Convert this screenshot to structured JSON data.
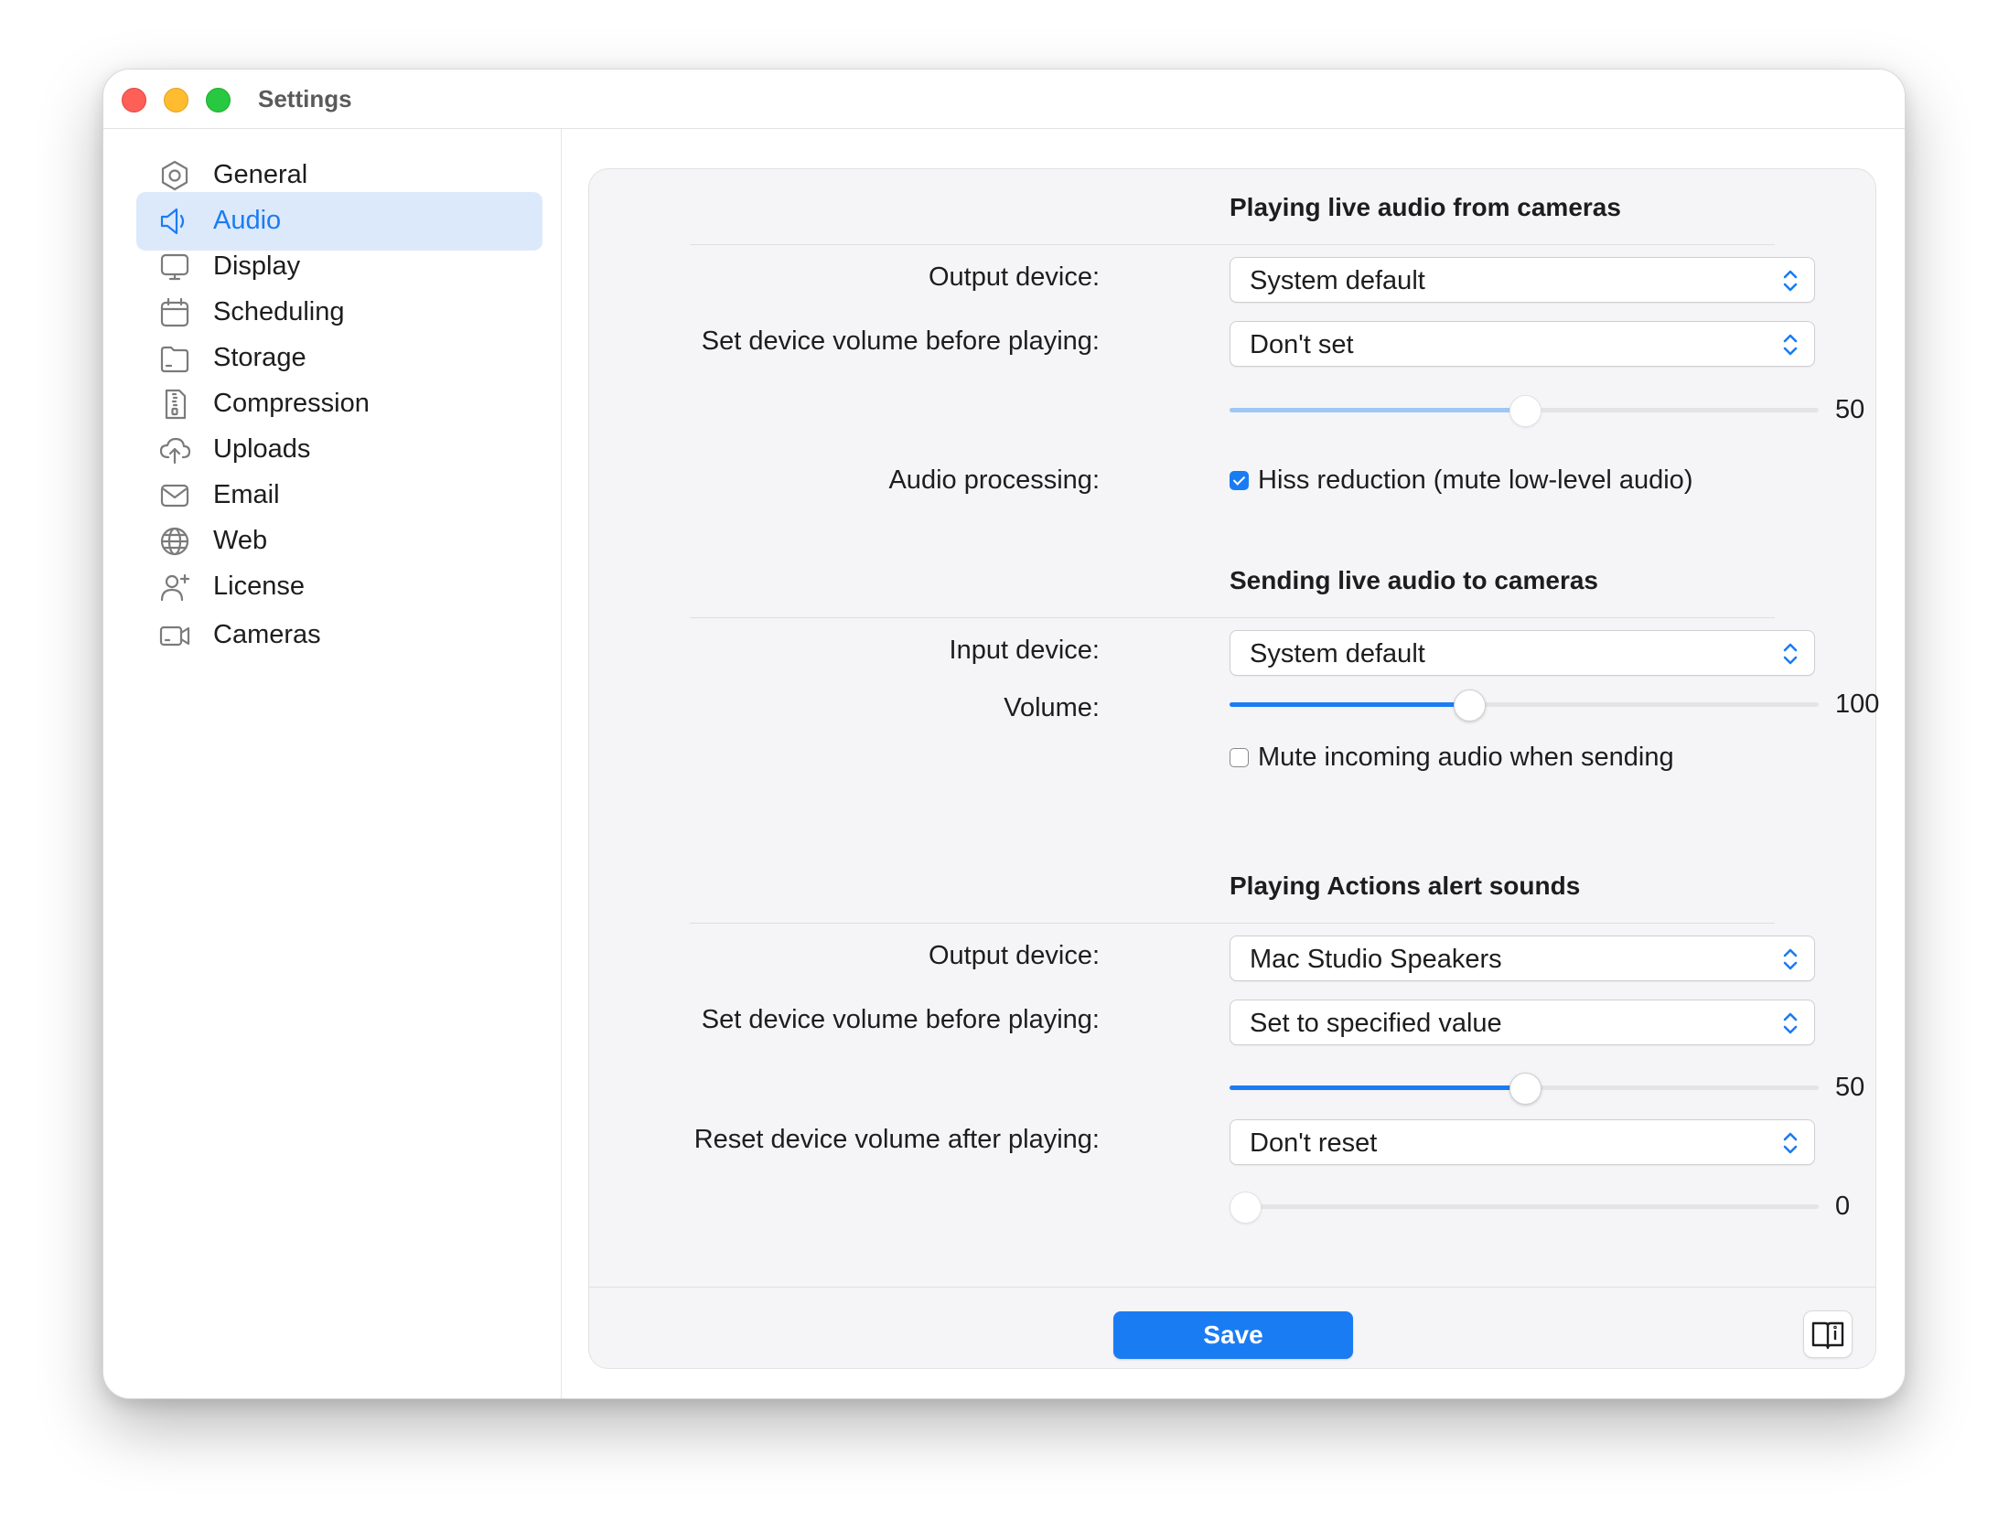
{
  "window": {
    "title": "Settings"
  },
  "sidebar": {
    "items": [
      {
        "label": "General",
        "icon": "gear-icon"
      },
      {
        "label": "Audio",
        "icon": "speaker-icon",
        "active": true
      },
      {
        "label": "Display",
        "icon": "monitor-icon"
      },
      {
        "label": "Scheduling",
        "icon": "calendar-icon"
      },
      {
        "label": "Storage",
        "icon": "storage-icon"
      },
      {
        "label": "Compression",
        "icon": "zip-file-icon"
      },
      {
        "label": "Uploads",
        "icon": "cloud-upload-icon"
      },
      {
        "label": "Email",
        "icon": "envelope-icon"
      },
      {
        "label": "Web",
        "icon": "globe-icon"
      },
      {
        "label": "License",
        "icon": "person-add-icon"
      },
      {
        "label": "Cameras",
        "icon": "camera-icon"
      }
    ]
  },
  "sections": {
    "playing_live": {
      "title": "Playing live audio from cameras",
      "output_device_label": "Output device:",
      "output_device_value": "System default",
      "set_volume_label": "Set device volume before playing:",
      "set_volume_value": "Don't set",
      "volume_slider": {
        "value": "50",
        "fraction": 0.5
      },
      "audio_processing_label": "Audio processing:",
      "hiss_reduction_label": "Hiss reduction (mute low-level audio)",
      "hiss_reduction_checked": true
    },
    "sending_live": {
      "title": "Sending live audio to cameras",
      "input_device_label": "Input device:",
      "input_device_value": "System default",
      "volume_label": "Volume:",
      "volume_slider": {
        "value": "100",
        "fraction": 0.4
      },
      "mute_incoming_label": "Mute incoming audio when sending",
      "mute_incoming_checked": false
    },
    "actions_alerts": {
      "title": "Playing Actions alert sounds",
      "output_device_label": "Output device:",
      "output_device_value": "Mac Studio Speakers",
      "set_volume_label": "Set device volume before playing:",
      "set_volume_value": "Set to specified value",
      "volume_slider": {
        "value": "50",
        "fraction": 0.5
      },
      "reset_volume_label": "Reset device volume after playing:",
      "reset_volume_value": "Don't reset",
      "reset_slider": {
        "value": "0",
        "fraction": 0.0
      }
    }
  },
  "footer": {
    "save_label": "Save",
    "help_icon": "book-info-icon"
  },
  "colors": {
    "accent": "#1a7cf3",
    "sidebar_active_bg": "#dce9fb",
    "panel_bg": "#f5f5f7"
  }
}
